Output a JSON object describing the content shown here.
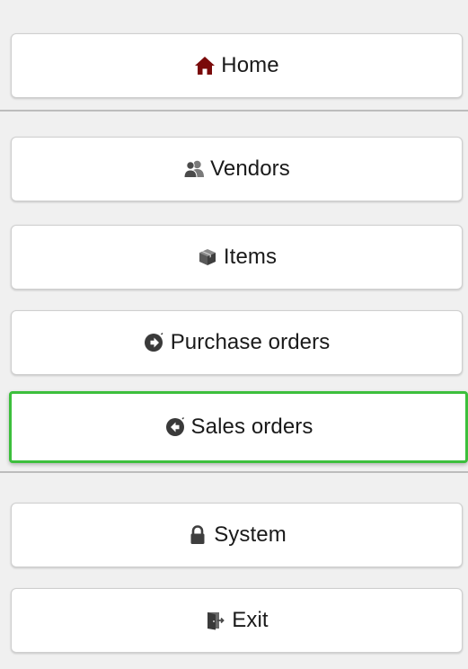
{
  "nav": {
    "home": {
      "label": "Home",
      "icon": "home-icon"
    },
    "vendors": {
      "label": "Vendors",
      "icon": "users-icon"
    },
    "items": {
      "label": "Items",
      "icon": "cube-icon"
    },
    "purchase_orders": {
      "label": "Purchase orders",
      "icon": "arrow-circle-right-icon"
    },
    "sales_orders": {
      "label": "Sales orders",
      "icon": "arrow-circle-left-icon",
      "selected": true
    },
    "system": {
      "label": "System",
      "icon": "lock-icon"
    },
    "exit": {
      "label": "Exit",
      "icon": "exit-door-icon"
    }
  },
  "colors": {
    "home_icon": "#7a0a0a",
    "selected_border": "#3cbf3c",
    "icon_gray": "#5a5a5a"
  }
}
